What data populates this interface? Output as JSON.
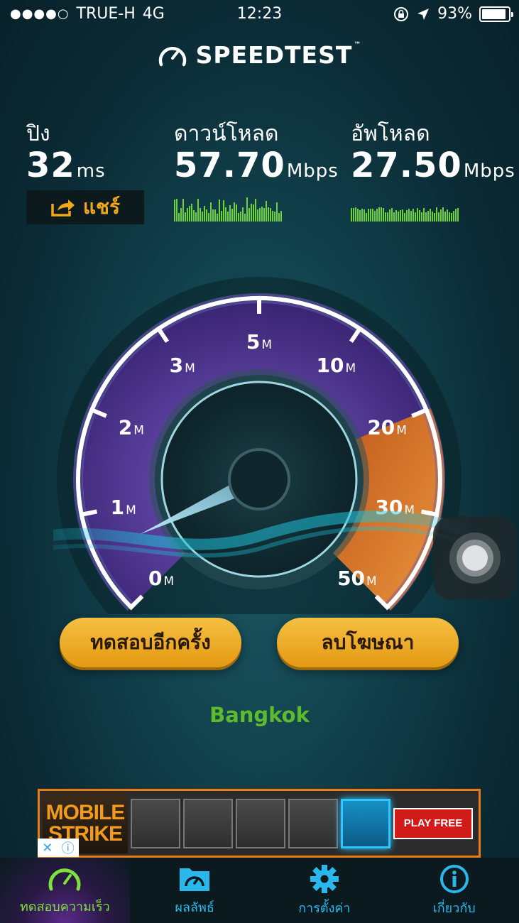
{
  "status_bar": {
    "signal": "●●●●○",
    "carrier": "TRUE-H",
    "network": "4G",
    "time": "12:23",
    "battery": "93%",
    "battery_level": 0.93
  },
  "logo": {
    "text": "SPEEDTEST",
    "tm": "™"
  },
  "stats": {
    "ping": {
      "label": "ปิง",
      "value": "32",
      "unit": "ms"
    },
    "download": {
      "label": "ดาวน์โหลด",
      "value": "57.70",
      "unit": "Mbps"
    },
    "upload": {
      "label": "อัพโหลด",
      "value": "27.50",
      "unit": "Mbps"
    },
    "share_label": "แชร์"
  },
  "gauge": {
    "ticks": [
      "0",
      "1",
      "2",
      "3",
      "5",
      "10",
      "20",
      "30",
      "50"
    ],
    "unit": "M",
    "needle_value": 0.6
  },
  "buttons": {
    "retest": "ทดสอบอีกครั้ง",
    "remove_ads": "ลบโฆษณา"
  },
  "city": "Bangkok",
  "ad": {
    "title_line1": "MOBILE",
    "title_line2": "STRIKE",
    "cta": "PLAY FREE",
    "close": "✕",
    "info": "ⓘ"
  },
  "tabs": [
    {
      "label": "ทดสอบความเร็ว",
      "icon": "speedometer-icon",
      "active": true
    },
    {
      "label": "ผลลัพธ์",
      "icon": "results-folder-icon",
      "active": false
    },
    {
      "label": "การตั้งค่า",
      "icon": "gear-icon",
      "active": false
    },
    {
      "label": "เกี่ยวกับ",
      "icon": "info-icon",
      "active": false
    }
  ],
  "colors": {
    "accent_green": "#7ee03a",
    "accent_blue": "#2ab8ec",
    "button_orange": "#f5c043",
    "gauge_purple": "#5a3fa0",
    "gauge_orange": "#d9722a"
  }
}
